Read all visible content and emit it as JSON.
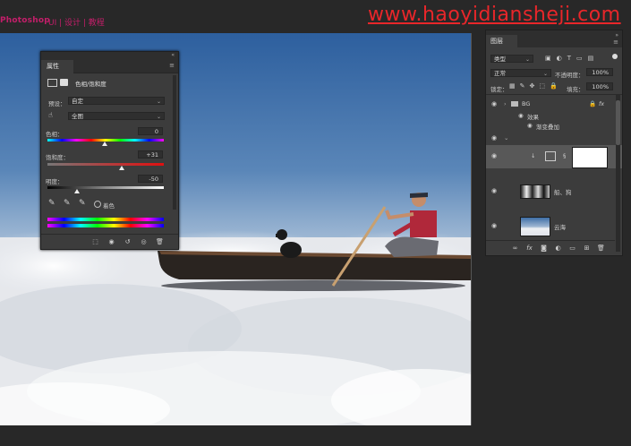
{
  "header": {
    "brand": "Photoshop",
    "tagline": "UI | 设计 | 教程",
    "site_url": "www.haoyidiansheji.com"
  },
  "properties": {
    "tab": "属性",
    "adjustment_name": "色相/饱和度",
    "preset_label": "预设：",
    "preset_value": "自定",
    "channel_value": "全图",
    "hue_label": "色相：",
    "hue_value": "0",
    "saturation_label": "饱和度：",
    "saturation_value": "+31",
    "lightness_label": "明度：",
    "lightness_value": "-50",
    "colorize_label": "着色",
    "colorize_checked": false
  },
  "layers": {
    "tab": "图层",
    "filter_kind": "类型",
    "blend_mode": "正常",
    "opacity_label": "不透明度：",
    "opacity_value": "100%",
    "lock_label": "锁定：",
    "fill_label": "填充：",
    "fill_value": "100%",
    "items": [
      {
        "name": "BG",
        "type": "group",
        "visible": true,
        "has_fx": true
      },
      {
        "name": "效果",
        "type": "effects-header",
        "visible": true
      },
      {
        "name": "渐变叠加",
        "type": "effect",
        "visible": true
      },
      {
        "name": "",
        "type": "group-empty",
        "visible": true
      },
      {
        "name": "",
        "type": "adjustment",
        "visible": true,
        "selected": true
      },
      {
        "name": "船、狗",
        "type": "pixel",
        "visible": true
      },
      {
        "name": "云海",
        "type": "pixel",
        "visible": true
      }
    ]
  },
  "colors": {
    "app_bg": "#282828",
    "panel_bg": "#3c3c3c",
    "accent_url": "#e8262a",
    "brand": "#c41e6a"
  }
}
